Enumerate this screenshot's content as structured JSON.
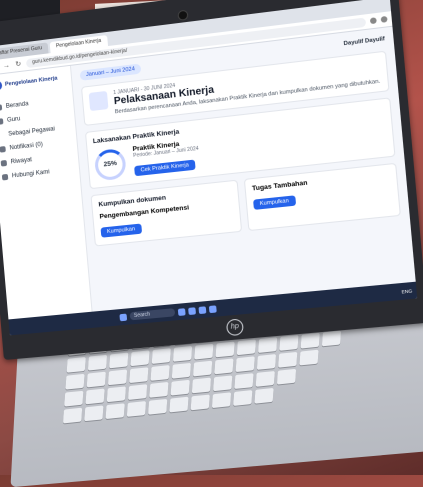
{
  "browser": {
    "tabs": [
      "Daftar Presensi Guru",
      "Pengelolaan Kinerja"
    ],
    "url": "guru.kemdikbud.go.id/pengelolaan-kinerja/"
  },
  "sidebar": {
    "brand": "Pengelolaan Kinerja",
    "items": [
      {
        "label": "Beranda"
      },
      {
        "label": "Guru"
      },
      {
        "label": "Sebagai Pegawai"
      },
      {
        "label": "Notifikasi (0)"
      },
      {
        "label": "Riwayat"
      },
      {
        "label": "Hubungi Kami"
      }
    ]
  },
  "header": {
    "period": "Januari – Juni 2024",
    "user": "Dayulif Dayulif"
  },
  "hero": {
    "date": "1 JANUARI - 30 JUNI 2024",
    "title": "Pelaksanaan Kinerja",
    "desc": "Berdasarkan perencanaan Anda, laksanakan Praktik Kinerja dan kumpulkan dokumen yang dibutuhkan."
  },
  "practice": {
    "section": "Laksanakan Praktik Kinerja",
    "percent": "25%",
    "title": "Praktik Kinerja",
    "period": "Periode: Januari – Juni 2024",
    "button": "Cek Praktik Kinerja"
  },
  "documents": {
    "section": "Kumpulkan dokumen",
    "item1": "Pengembangan Kompetensi",
    "item1_button": "Kumpulkan",
    "item2": "Tugas Tambahan",
    "item2_button": "Kumpulkan"
  },
  "taskbar": {
    "search": "Search",
    "tray": "ENG"
  },
  "laptop": {
    "logo": "hp"
  }
}
